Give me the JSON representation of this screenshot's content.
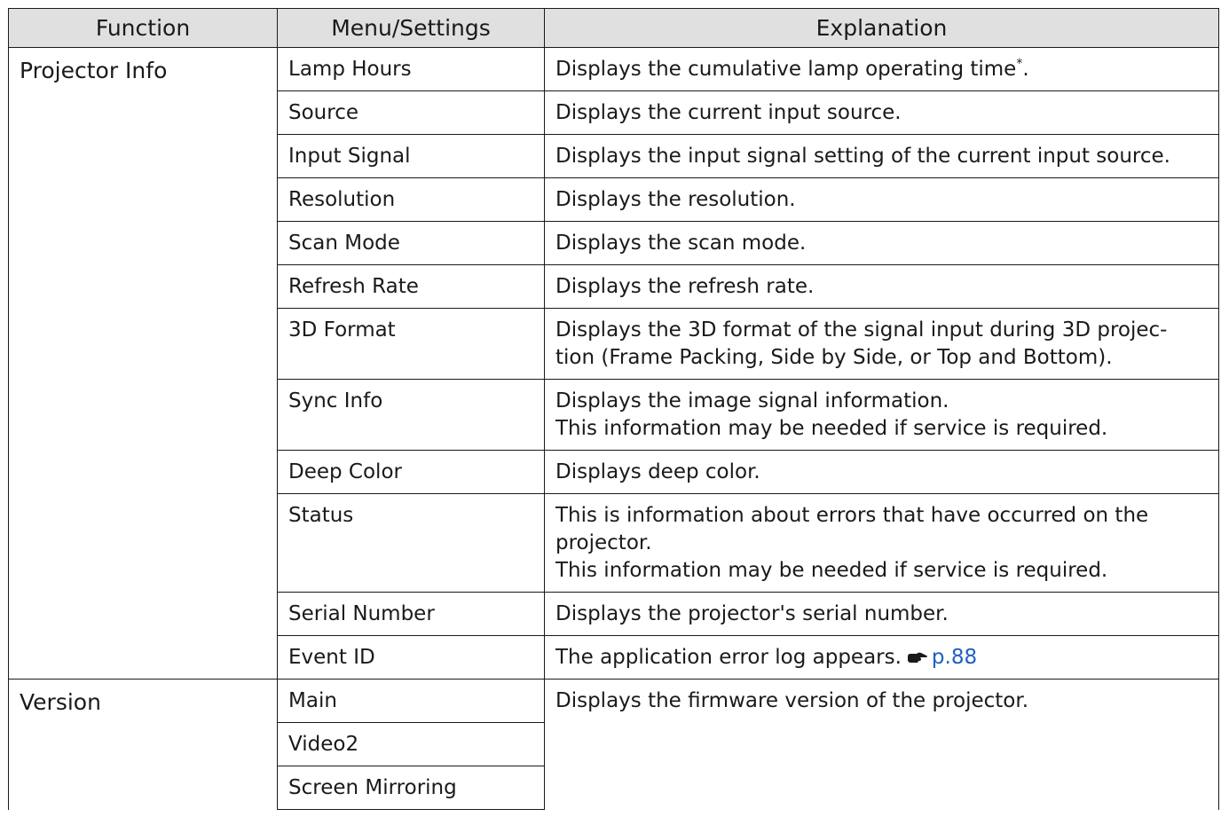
{
  "table": {
    "headers": [
      "Function",
      "Menu/Settings",
      "Explanation"
    ],
    "groups": [
      {
        "function": "Projector Info",
        "rows": [
          {
            "setting": "Lamp Hours",
            "explanation": [
              "Displays the cumulative lamp operating time"
            ],
            "footnote": "*",
            "suffix": "."
          },
          {
            "setting": "Source",
            "explanation": [
              "Displays the current input source."
            ]
          },
          {
            "setting": "Input Signal",
            "explanation": [
              "Displays the input signal setting of the current input source."
            ]
          },
          {
            "setting": "Resolution",
            "explanation": [
              "Displays the resolution."
            ]
          },
          {
            "setting": "Scan Mode",
            "explanation": [
              "Displays the scan mode."
            ]
          },
          {
            "setting": "Refresh Rate",
            "explanation": [
              "Displays the refresh rate."
            ]
          },
          {
            "setting": "3D Format",
            "explanation": [
              "Displays the 3D format of the signal input during 3D projec-",
              "tion (Frame Packing, Side by Side, or Top and Bottom)."
            ]
          },
          {
            "setting": "Sync Info",
            "explanation": [
              "Displays the image signal information.",
              "This information may be needed if service is required."
            ]
          },
          {
            "setting": "Deep Color",
            "explanation": [
              "Displays deep color."
            ]
          },
          {
            "setting": "Status",
            "explanation": [
              "This is information about errors that have occurred on the",
              "projector.",
              "This information may be needed if service is required."
            ]
          },
          {
            "setting": "Serial Number",
            "explanation": [
              "Displays the projector's serial number."
            ]
          },
          {
            "setting": "Event ID",
            "explanation": [
              "The application error log appears."
            ],
            "link": "p.88",
            "icon": "pointing-hand-icon"
          }
        ]
      },
      {
        "function": "Version",
        "settings": [
          "Main",
          "Video2",
          "Screen Mirroring"
        ],
        "explanation": "Displays the firmware version of the projector."
      }
    ]
  },
  "colors": {
    "header_bg": "#e0e0e0",
    "border": "#1a1a1a",
    "link": "#2060c0"
  }
}
